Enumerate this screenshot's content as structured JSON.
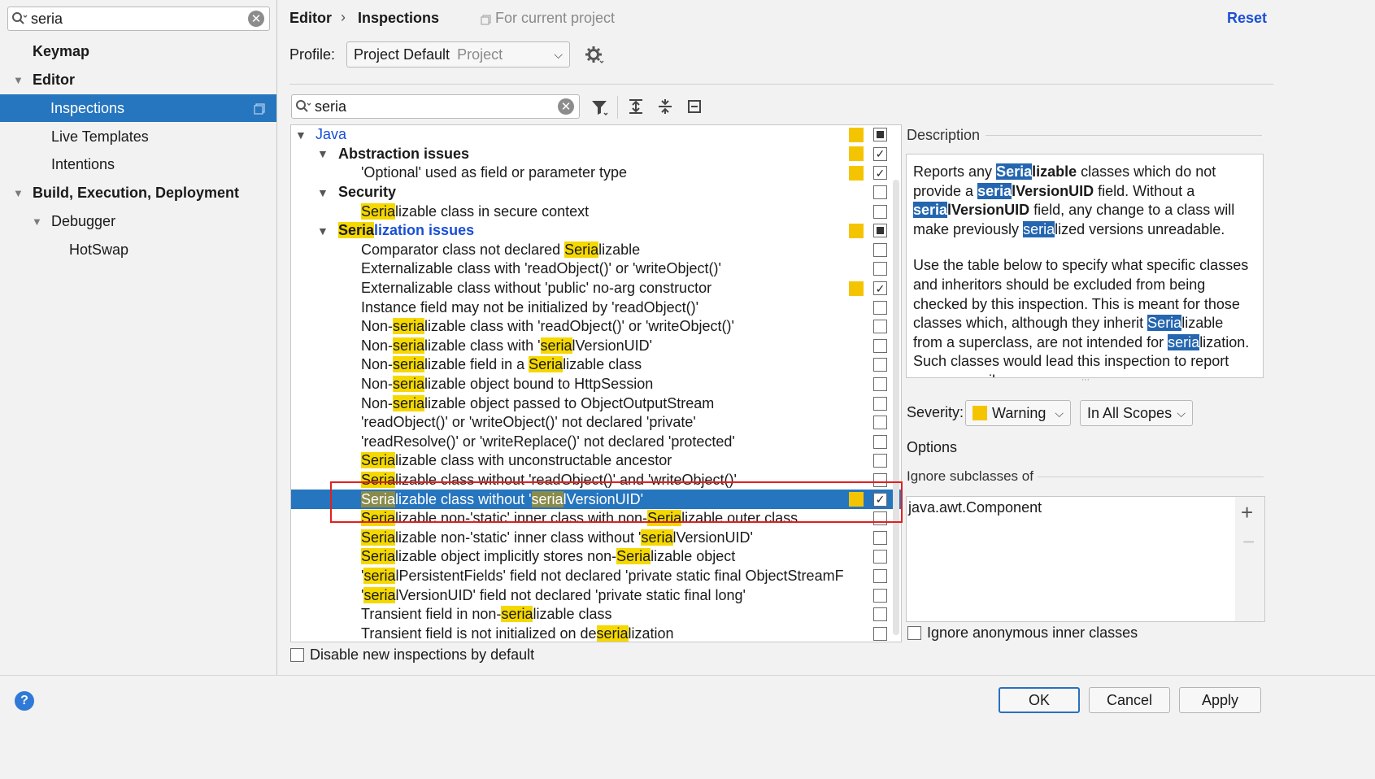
{
  "sidebar": {
    "search_value": "seria",
    "items": [
      {
        "label": "Keymap"
      },
      {
        "label": "Editor"
      },
      {
        "label": "Inspections"
      },
      {
        "label": "Live Templates"
      },
      {
        "label": "Intentions"
      },
      {
        "label": "Build, Execution, Deployment"
      },
      {
        "label": "Debugger"
      },
      {
        "label": "HotSwap"
      }
    ]
  },
  "header": {
    "crumb_parent": "Editor",
    "crumb_sep": "›",
    "crumb_current": "Inspections",
    "scope_note": "For current project",
    "reset_label": "Reset"
  },
  "profile": {
    "label": "Profile:",
    "value": "Project Default",
    "value_suffix": "Project"
  },
  "filter": {
    "search_value": "seria"
  },
  "tree": {
    "rows": [
      {
        "label": "Java",
        "severity": true,
        "check": "partial"
      },
      {
        "label": "Abstraction issues",
        "severity": true,
        "check": "checked"
      },
      {
        "label": "'Optional' used as field or parameter type",
        "severity": true,
        "check": "checked"
      },
      {
        "label": "Security",
        "severity": false,
        "check": "unchecked"
      },
      {
        "label": "Serializable class in secure context",
        "severity": false,
        "check": "unchecked"
      },
      {
        "label": "Serialization issues",
        "severity": true,
        "check": "partial"
      },
      {
        "label": "Comparator class not declared Serializable",
        "severity": false,
        "check": "unchecked"
      },
      {
        "label": "Externalizable class with 'readObject()' or 'writeObject()'",
        "severity": false,
        "check": "unchecked"
      },
      {
        "label": "Externalizable class without 'public' no-arg constructor",
        "severity": true,
        "check": "checked"
      },
      {
        "label": "Instance field may not be initialized by 'readObject()'",
        "severity": false,
        "check": "unchecked"
      },
      {
        "label": "Non-serializable class with 'readObject()' or 'writeObject()'",
        "severity": false,
        "check": "unchecked"
      },
      {
        "label": "Non-serializable class with 'serialVersionUID'",
        "severity": false,
        "check": "unchecked"
      },
      {
        "label": "Non-serializable field in a Serializable class",
        "severity": false,
        "check": "unchecked"
      },
      {
        "label": "Non-serializable object bound to HttpSession",
        "severity": false,
        "check": "unchecked"
      },
      {
        "label": "Non-serializable object passed to ObjectOutputStream",
        "severity": false,
        "check": "unchecked"
      },
      {
        "label": "'readObject()' or 'writeObject()' not declared 'private'",
        "severity": false,
        "check": "unchecked"
      },
      {
        "label": "'readResolve()' or 'writeReplace()' not declared 'protected'",
        "severity": false,
        "check": "unchecked"
      },
      {
        "label": "Serializable class with unconstructable ancestor",
        "severity": false,
        "check": "unchecked"
      },
      {
        "label": "Serializable class without 'readObject()' and 'writeObject()'",
        "severity": false,
        "check": "unchecked"
      },
      {
        "label": "Serializable class without 'serialVersionUID'",
        "severity": true,
        "check": "checked"
      },
      {
        "label": "Serializable non-'static' inner class with non-Serializable outer class",
        "severity": false,
        "check": "unchecked"
      },
      {
        "label": "Serializable non-'static' inner class without 'serialVersionUID'",
        "severity": false,
        "check": "unchecked"
      },
      {
        "label": "Serializable object implicitly stores non-Serializable object",
        "severity": false,
        "check": "unchecked"
      },
      {
        "label": "'serialPersistentFields' field not declared 'private static final ObjectStreamF",
        "severity": false,
        "check": "unchecked"
      },
      {
        "label": "'serialVersionUID' field not declared 'private static final long'",
        "severity": false,
        "check": "unchecked"
      },
      {
        "label": "Transient field in non-serializable class",
        "severity": false,
        "check": "unchecked"
      },
      {
        "label": "Transient field is not initialized on deserialization",
        "severity": false,
        "check": "unchecked"
      }
    ],
    "disable_new_label": "Disable new inspections by default"
  },
  "description": {
    "section_label": "Description",
    "p1": [
      "Reports any ",
      "Seria",
      "lizable",
      " classes which do not provide a ",
      "seria",
      "lVersionUID",
      " field. Without a ",
      "seria",
      "lVersionUID",
      " field, any change to a class will make previously ",
      "seria",
      "lized versions unreadable."
    ],
    "p2": [
      "Use the table below to specify what specific classes and inheritors should be excluded from being checked by this inspection. This is meant for those classes which, although they inherit ",
      "Seria",
      "lizable from a superclass, are not intended for ",
      "seria",
      "lization. Such classes would lead this inspection to report unnecessarily."
    ]
  },
  "severity": {
    "label": "Severity:",
    "value": "Warning",
    "color": "#f5c400",
    "scope": "In All Scopes"
  },
  "options": {
    "label": "Options",
    "ignore_subclasses_label": "Ignore subclasses of",
    "classes": [
      "java.awt.Component"
    ],
    "ignore_anonymous_label": "Ignore anonymous inner classes"
  },
  "buttons": {
    "ok": "OK",
    "cancel": "Cancel",
    "apply": "Apply"
  },
  "colors": {
    "selection": "#2675bf",
    "highlight": "#f5d800",
    "link_blue": "#1a4fd6"
  }
}
